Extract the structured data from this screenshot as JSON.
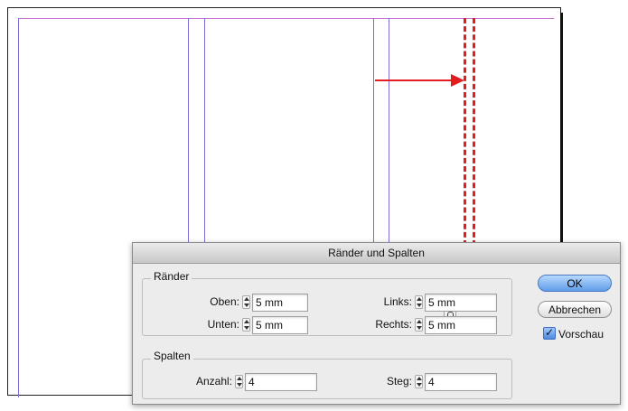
{
  "dialog": {
    "title": "Ränder und Spalten",
    "margins_group": {
      "label": "Ränder",
      "top_label": "Oben:",
      "top_value": "5 mm",
      "bottom_label": "Unten:",
      "bottom_value": "5 mm",
      "left_label": "Links:",
      "left_value": "5 mm",
      "right_label": "Rechts:",
      "right_value": "5 mm",
      "link_icon": "chain-link-icon"
    },
    "columns_group": {
      "label": "Spalten",
      "count_label": "Anzahl:",
      "count_value": "4",
      "gutter_label": "Steg:",
      "gutter_value": "4"
    },
    "buttons": {
      "ok_label": "OK",
      "cancel_label": "Abbrechen"
    },
    "preview": {
      "label": "Vorschau",
      "checked": true
    }
  },
  "colors": {
    "margin_guide": "#c66fd0",
    "column_guide": "#7a6fd6",
    "annotation": "#e21d1d",
    "ok_button": "#5f9de8"
  }
}
